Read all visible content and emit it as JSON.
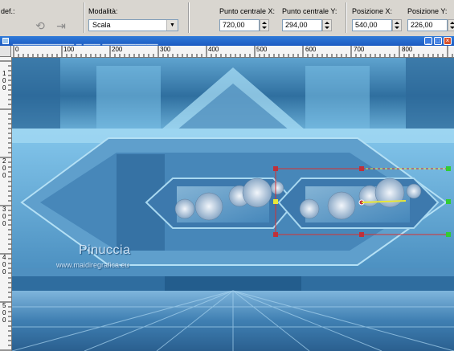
{
  "toolbar": {
    "preset_label": "def.:",
    "mode_label": "Modalità:",
    "mode_value": "Scala",
    "center_x_label": "Punto centrale X:",
    "center_x_value": "720,00",
    "center_y_label": "Punto centrale Y:",
    "center_y_value": "294,00",
    "pos_x_label": "Posizione X:",
    "pos_x_value": "540,00",
    "pos_y_label": "Posizione Y:",
    "pos_y_value": "226,00"
  },
  "ruler": {
    "h_labels": [
      "0",
      "100",
      "200",
      "300",
      "400",
      "500",
      "600",
      "700",
      "800"
    ],
    "v_labels": [
      [
        "1",
        "0",
        "0"
      ],
      [
        "2",
        "0",
        "0"
      ],
      [
        "3",
        "0",
        "0"
      ],
      [
        "4",
        "0",
        "0"
      ],
      [
        "5",
        "0",
        "0"
      ]
    ]
  },
  "watermark": {
    "title": "Pinuccia",
    "url": "www.maidiregrafica.eu"
  },
  "colors": {
    "canvas_dark": "#1e5a8c",
    "canvas_light": "#9fd3ee",
    "handle": "#c0303a",
    "selection_line": "#d93030",
    "accent_yellow": "#e8e838"
  }
}
